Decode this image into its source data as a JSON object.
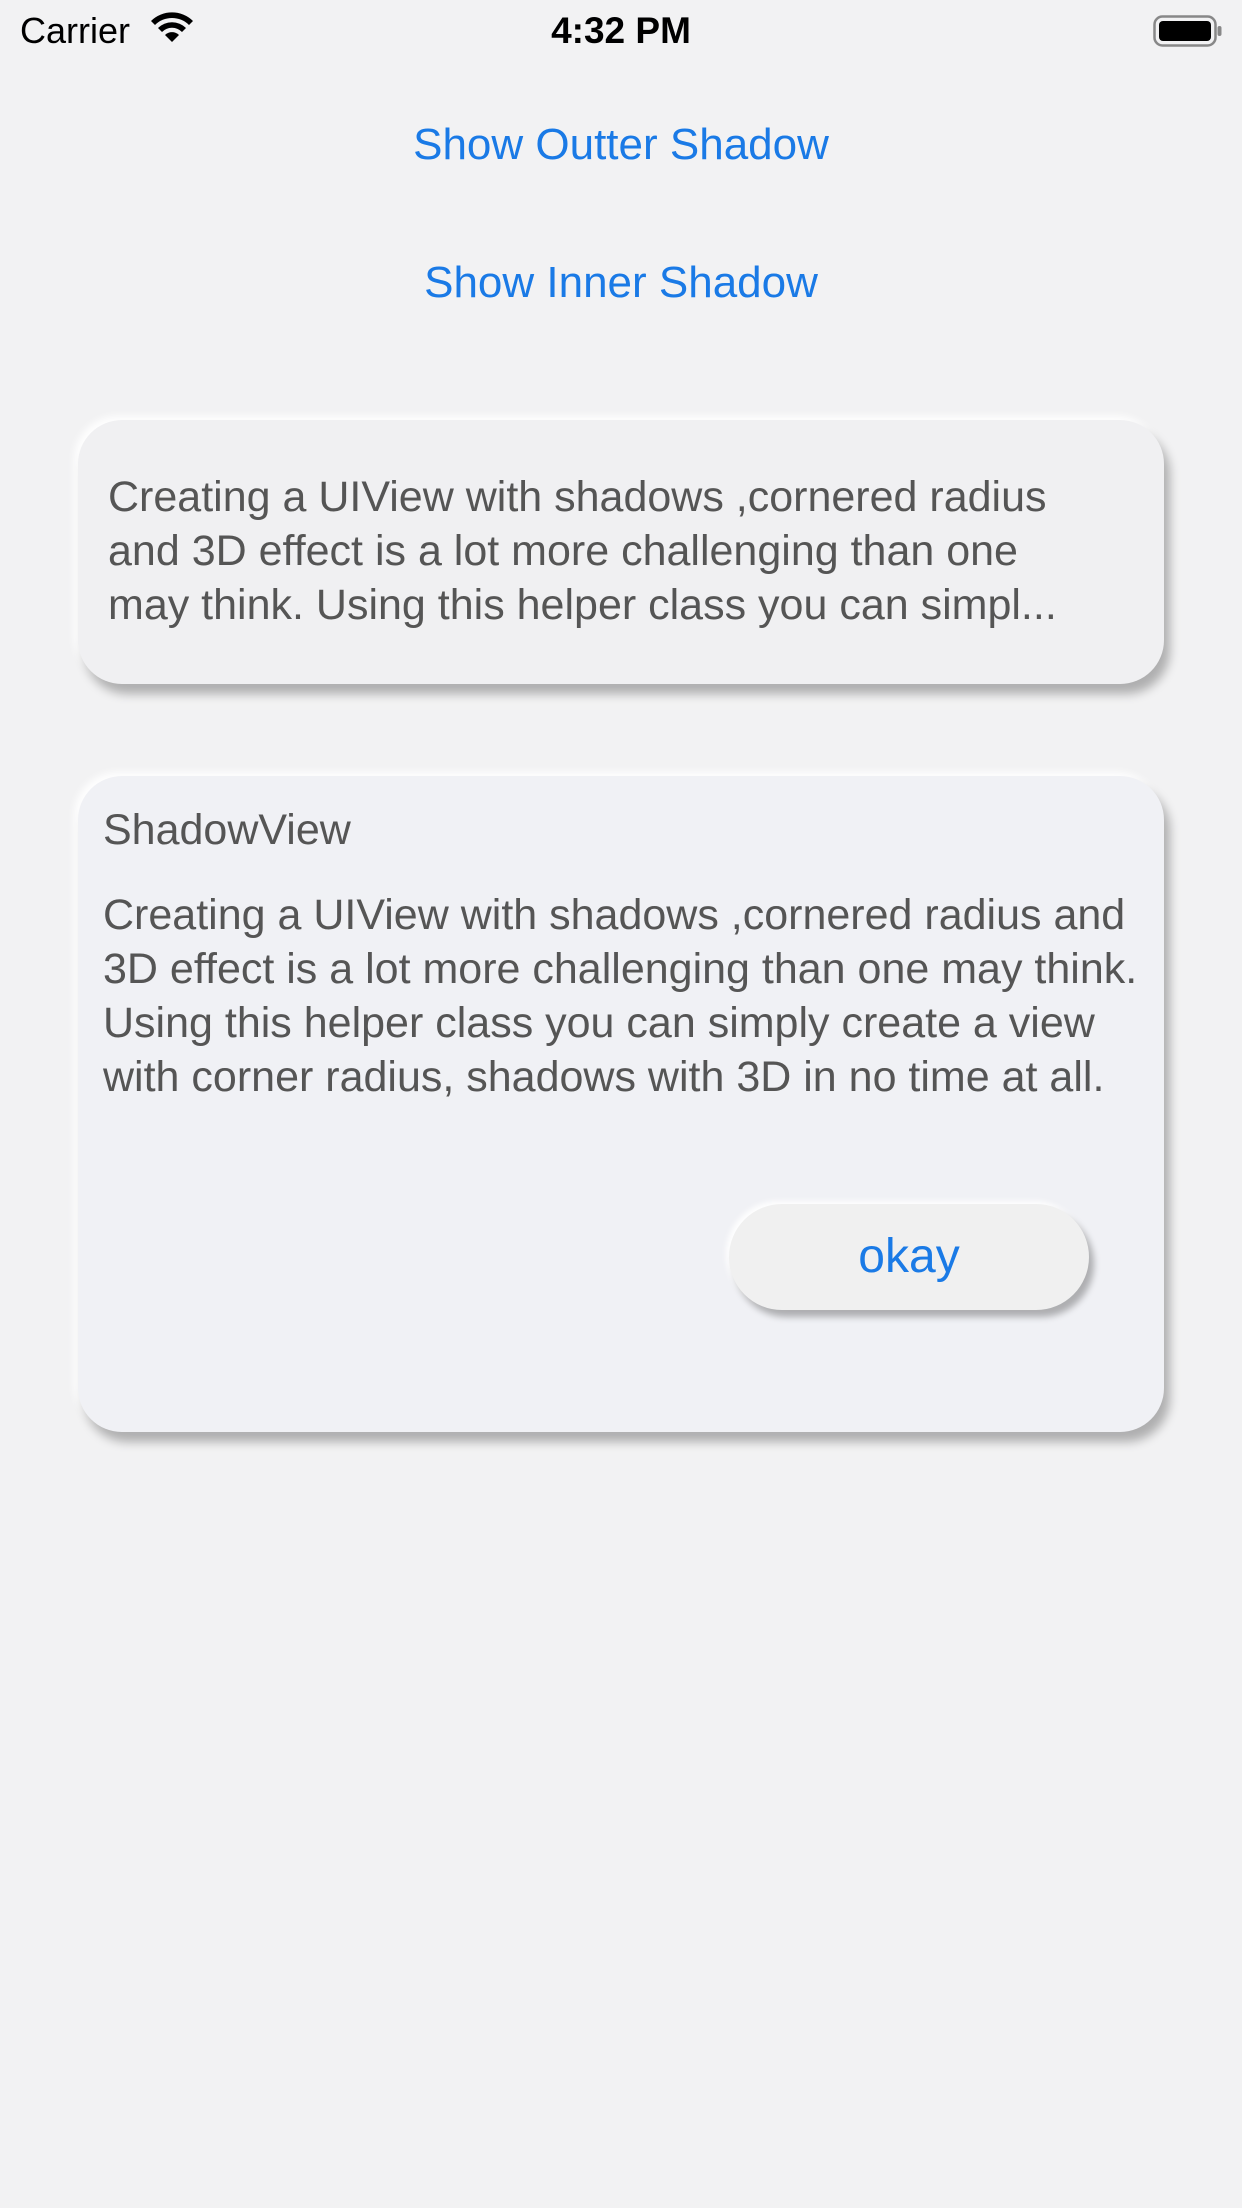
{
  "status_bar": {
    "carrier": "Carrier",
    "time": "4:32 PM",
    "wifi_icon": "wifi-icon",
    "battery_icon": "battery-icon"
  },
  "buttons": {
    "show_outer_shadow": "Show Outter Shadow",
    "show_inner_shadow": "Show Inner Shadow"
  },
  "card_1": {
    "text": "Creating a UIView with shadows ,cornered radius\nand 3D effect is a lot more challenging than one\nmay think. Using this helper class you can simpl..."
  },
  "card_2": {
    "title": "ShadowView",
    "text": "Creating a UIView with shadows ,cornered radius and 3D effect is a lot more challenging than one may think. Using this helper class you can simply create a view with corner radius, shadows with 3D in no time at all.",
    "button_label": "okay"
  },
  "colors": {
    "accent": "#1a7ae6",
    "background": "#f2f2f3",
    "body_text": "#555555"
  }
}
